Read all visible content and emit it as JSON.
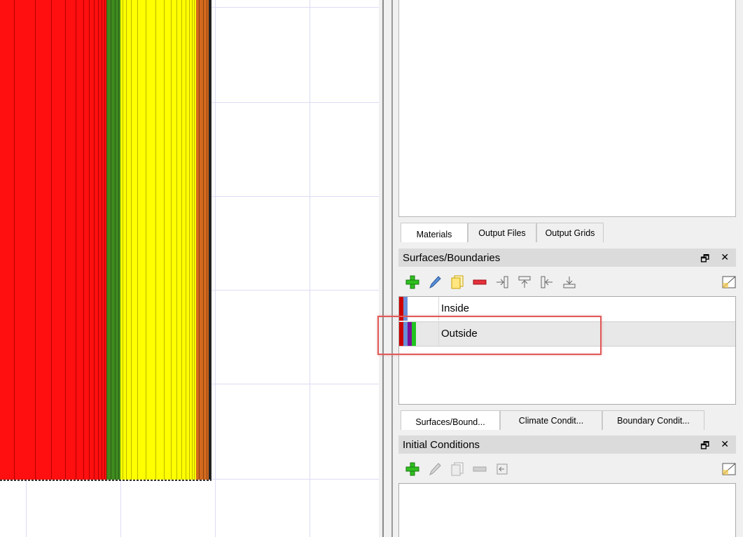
{
  "colors": {
    "red_layer": "#ff0f0f",
    "green_layer": "#3f8a1f",
    "yellow_layer": "#ffff00",
    "orange_layer": "#d2691e",
    "grid": "#dcdcf5",
    "highlight": "#e05a5a"
  },
  "top_tabs": [
    {
      "label": "Materials",
      "active": true
    },
    {
      "label": "Output Files",
      "active": false
    },
    {
      "label": "Output Grids",
      "active": false
    }
  ],
  "surfaces_panel": {
    "title": "Surfaces/Boundaries",
    "toolbar": [
      "add-icon",
      "edit-icon",
      "copy-icon",
      "remove-icon",
      "assign-left-icon",
      "assign-top-icon",
      "assign-right-icon",
      "assign-bottom-icon",
      "toggle-view-icon"
    ],
    "items": [
      {
        "label": "Inside",
        "selected": false,
        "swatches": [
          "#cc0000",
          "#6a8fd8"
        ]
      },
      {
        "label": "Outside",
        "selected": true,
        "swatches": [
          "#cc0000",
          "#6a8fd8",
          "#7a0f9a",
          "#22c422"
        ]
      }
    ]
  },
  "bottom_tabs": [
    {
      "label": "Surfaces/Bound...",
      "active": true
    },
    {
      "label": "Climate Condit...",
      "active": false
    },
    {
      "label": "Boundary Condit...",
      "active": false
    }
  ],
  "initial_panel": {
    "title": "Initial Conditions",
    "toolbar": [
      "add-icon",
      "edit-icon",
      "copy-icon",
      "remove-icon",
      "assign-icon",
      "toggle-view-icon"
    ]
  },
  "panel_buttons": {
    "float": "🗗",
    "close": "✕"
  }
}
